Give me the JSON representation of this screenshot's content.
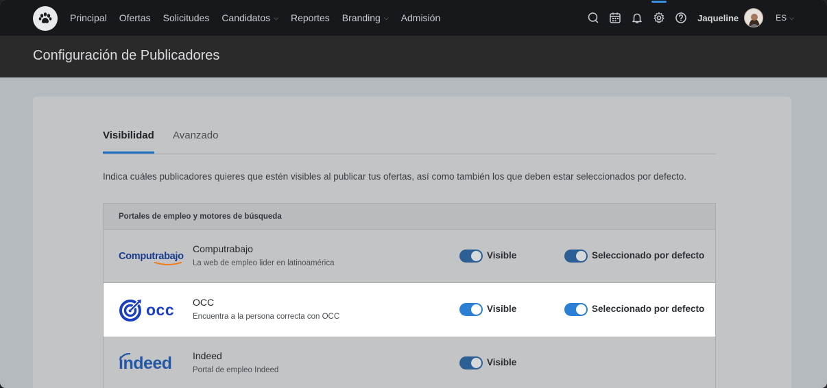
{
  "nav": {
    "items": [
      {
        "label": "Principal",
        "dropdown": false
      },
      {
        "label": "Ofertas",
        "dropdown": false
      },
      {
        "label": "Solicitudes",
        "dropdown": false
      },
      {
        "label": "Candidatos",
        "dropdown": true
      },
      {
        "label": "Reportes",
        "dropdown": false
      },
      {
        "label": "Branding",
        "dropdown": true
      },
      {
        "label": "Admisión",
        "dropdown": false
      }
    ],
    "user_name": "Jaqueline",
    "language": "ES",
    "icons": [
      "chat-icon",
      "calendar-icon",
      "bell-icon",
      "gear-icon",
      "help-icon"
    ],
    "active_icon": "gear-icon"
  },
  "page": {
    "title": "Configuración de Publicadores"
  },
  "tabs": [
    {
      "label": "Visibilidad",
      "active": true
    },
    {
      "label": "Avanzado",
      "active": false
    }
  ],
  "description": "Indica cuáles publicadores quieres que estén visibles al publicar tus ofertas, así como también los que deben estar seleccionados por defecto.",
  "table": {
    "header": "Portales de empleo y motores de búsqueda",
    "rows": [
      {
        "logo_text": "Computrabajo",
        "name": "Computrabajo",
        "description": "La web de empleo lider en latinoamérica",
        "visible": true,
        "visible_label": "Visible",
        "default": true,
        "default_label": "Seleccionado por defecto",
        "highlighted": false
      },
      {
        "logo_text": "occ",
        "name": "OCC",
        "description": "Encuentra a la persona correcta con OCC",
        "visible": true,
        "visible_label": "Visible",
        "default": true,
        "default_label": "Seleccionado por defecto",
        "highlighted": true
      },
      {
        "logo_text": "indeed",
        "name": "Indeed",
        "description": "Portal de empleo Indeed",
        "visible": true,
        "visible_label": "Visible",
        "highlighted": false
      }
    ]
  },
  "colors": {
    "accent": "#2b7fd4",
    "nav_bg": "#16181c",
    "brand_occ": "#1b3fbf",
    "brand_indeed": "#2557a7"
  }
}
